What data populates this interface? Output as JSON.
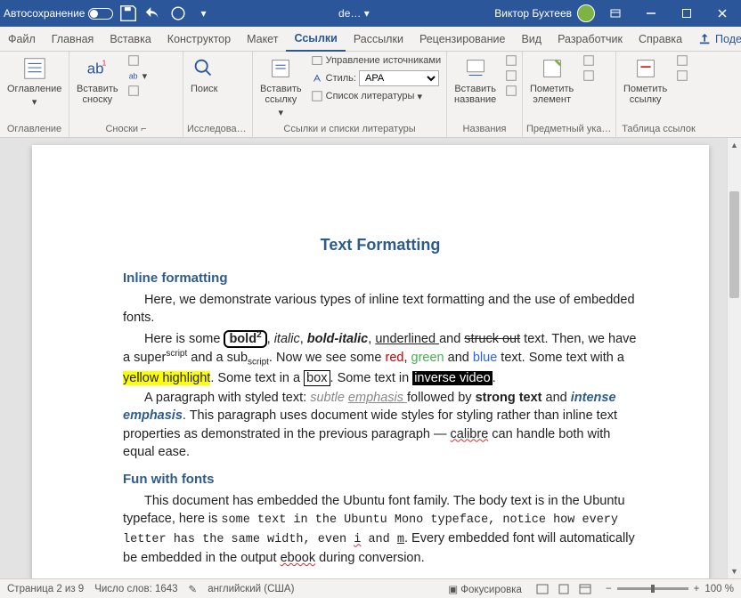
{
  "titlebar": {
    "autosave": "Автосохранение",
    "filename": "de…",
    "user": "Виктор Бухтеев"
  },
  "menu": {
    "file": "Файл",
    "home": "Главная",
    "insert": "Вставка",
    "design": "Конструктор",
    "layout": "Макет",
    "references": "Ссылки",
    "mailings": "Рассылки",
    "review": "Рецензирование",
    "view": "Вид",
    "developer": "Разработчик",
    "help": "Справка",
    "share": "Поделиться"
  },
  "ribbon": {
    "toc": {
      "btn": "Оглавление",
      "group": "Оглавление"
    },
    "footnotes": {
      "insert": "Вставить\nсноску",
      "group": "Сноски"
    },
    "research": {
      "search": "Поиск",
      "group": "Исследован…"
    },
    "citations": {
      "insert": "Вставить\nссылку",
      "manage": "Управление источниками",
      "styleLabel": "Стиль:",
      "styleValue": "APA",
      "biblio": "Список литературы",
      "group": "Ссылки и списки литературы"
    },
    "captions": {
      "insert": "Вставить\nназвание",
      "group": "Названия"
    },
    "index": {
      "mark": "Пометить\nэлемент",
      "group": "Предметный указ…"
    },
    "toa": {
      "mark": "Пометить\nссылку",
      "group": "Таблица ссылок"
    }
  },
  "doc": {
    "title": "Text Formatting",
    "h_inline": "Inline formatting",
    "p1a": "Here, we demonstrate various types of inline text formatting and the use of embedded fonts.",
    "p2_a": "Here is some",
    "p2_bold": "bold",
    "p2_sup2": "2",
    "p2_comma": ",",
    "p2_italic": "italic",
    "p2_comma2": ",",
    "p2_bi": "bold-italic",
    "p2_comma3": ",",
    "p2_under": "underlined ",
    "p2_and": "and",
    "p2_struck": "struck out",
    "p2_rest": " text. Then, we have a super",
    "p2_script": "script",
    "p2_mid": " and a sub",
    "p2_subscript": "script",
    "p2_now": ". Now we see some ",
    "p2_red": "red",
    "p2_c4": ", ",
    "p2_green": "green",
    "p2_and2": " and ",
    "p2_blue": "blue",
    "p2_txt": " text. Some text with a ",
    "p2_yellow": "yellow highlight",
    "p2_some": ". Some text in a ",
    "p2_box": "box",
    "p2_some2": ". Some text in ",
    "p2_inv": "inverse video",
    "p2_dot": ".",
    "p3_a": "A paragraph with styled text: ",
    "p3_subtle": "subtle ",
    "p3_emph": "emphasis ",
    "p3_follow": " followed",
    "p3_by": " by ",
    "p3_strong": "strong text",
    "p3_and": " and ",
    "p3_ie": "intense emphasis",
    "p3_rest": ". This paragraph uses document wide styles for styling rather than inline text properties as demonstrated in the previous paragraph — ",
    "p3_calibre": "calibre",
    "p3_rest2": " can handle both with equal ease.",
    "h_fonts": "Fun with fonts",
    "p4_a": "This document has embedded the Ubuntu font family. The body text is in the Ubuntu typeface, here is ",
    "p4_mono": "some text in the Ubuntu Mono typeface, notice how every letter has the same width, even ",
    "p4_i": "i",
    "p4_and": " and ",
    "p4_m": "m",
    "p4_rest": ". Every embedded font will automatically be embedded in the output ",
    "p4_ebook": "ebook",
    "p4_rest2": " during conversion."
  },
  "status": {
    "page": "Страница 2 из 9",
    "words": "Число слов: 1643",
    "lang": "английский (США)",
    "focus": "Фокусировка",
    "zoom": "100 %"
  }
}
